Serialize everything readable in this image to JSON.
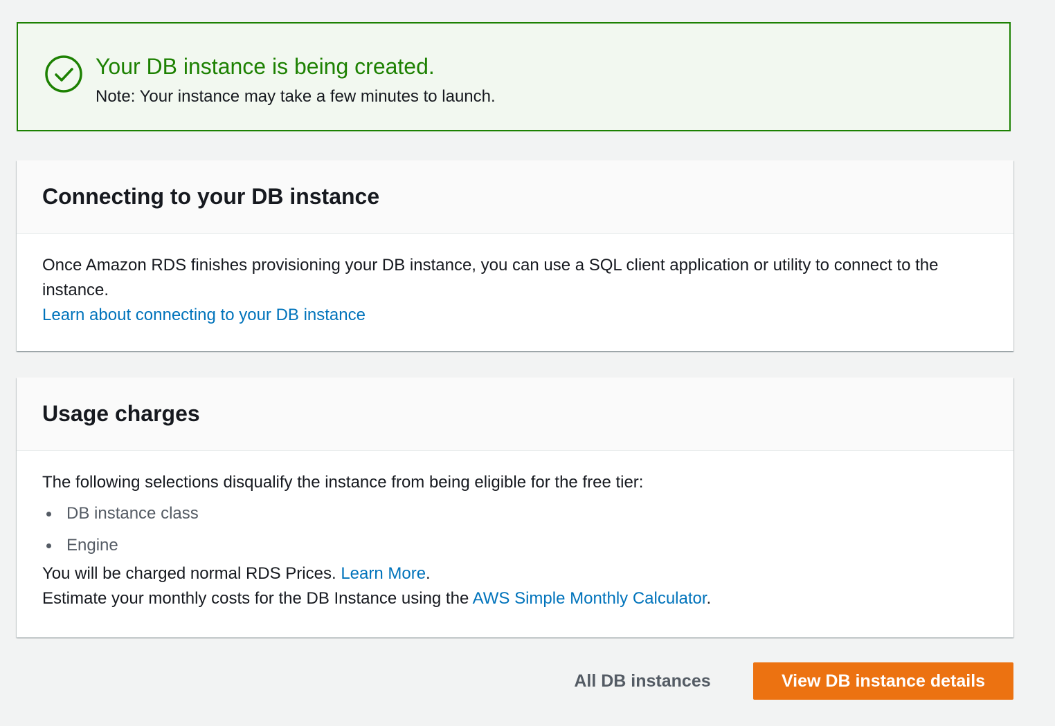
{
  "colors": {
    "success": "#1d8102",
    "success_bg": "#f2f8f0",
    "link": "#0073bb",
    "primary_button": "#ec7211",
    "page_bg": "#f2f3f3"
  },
  "flash": {
    "icon": "check-circle-icon",
    "title": "Your DB instance is being created.",
    "note": "Note: Your instance may take a few minutes to launch."
  },
  "connecting": {
    "title": "Connecting to your DB instance",
    "body": "Once Amazon RDS finishes provisioning your DB instance, you can use a SQL client application or utility to connect to the instance.",
    "link": "Learn about connecting to your DB instance"
  },
  "usage": {
    "title": "Usage charges",
    "intro": "The following selections disqualify the instance from being eligible for the free tier:",
    "items": [
      "DB instance class",
      "Engine"
    ],
    "charged_text": "You will be charged normal RDS Prices.",
    "learn_more": "Learn More",
    "period": ".",
    "estimate_text": "Estimate your monthly costs for the DB Instance using the",
    "calculator_link": "AWS Simple Monthly Calculator",
    "estimate_end": "."
  },
  "footer": {
    "all_instances": "All DB instances",
    "view_details": "View DB instance details"
  }
}
